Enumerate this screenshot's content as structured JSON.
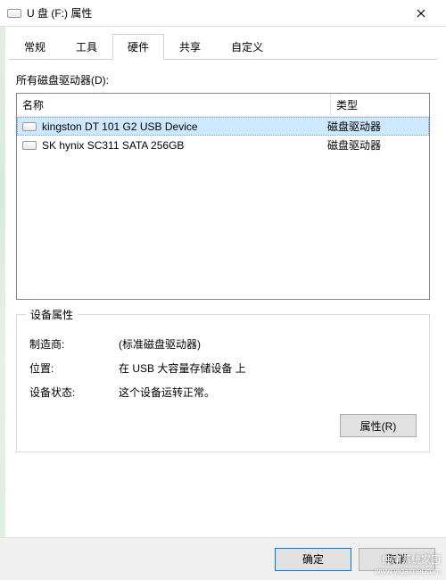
{
  "title": "U 盘 (F:) 属性",
  "tabs": [
    "常规",
    "工具",
    "硬件",
    "共享",
    "自定义"
  ],
  "active_tab": 2,
  "list_label": "所有磁盘驱动器(D):",
  "columns": {
    "name": "名称",
    "type": "类型"
  },
  "drives": [
    {
      "name": "kingston DT 101 G2 USB Device",
      "type": "磁盘驱动器",
      "selected": true
    },
    {
      "name": "SK hynix SC311 SATA 256GB",
      "type": "磁盘驱动器",
      "selected": false
    }
  ],
  "group_title": "设备属性",
  "fields": {
    "manufacturer": {
      "label": "制造商:",
      "value": "(标准磁盘驱动器)"
    },
    "location": {
      "label": "位置:",
      "value": "在 USB 大容量存储设备 上"
    },
    "status": {
      "label": "设备状态:",
      "value": "这个设备运转正常。"
    }
  },
  "buttons": {
    "properties": "属性(R)",
    "ok": "确定",
    "cancel": "取消"
  },
  "watermark": {
    "brand": "纯净系统家园",
    "url": "www.yidaimei.com"
  }
}
